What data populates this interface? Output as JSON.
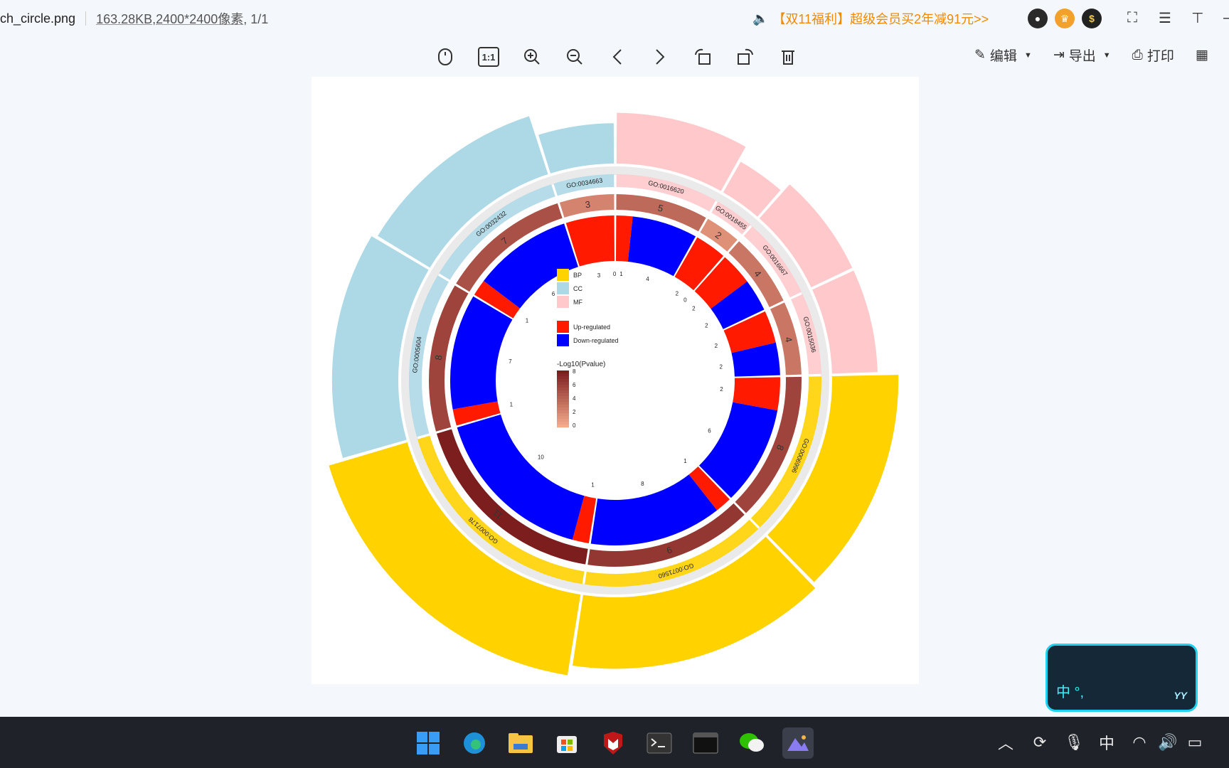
{
  "titlebar": {
    "filename": "ch_circle.png",
    "filesize": "163.28KB",
    "dimensions": ",2400*2400像素",
    "page": ", 1/1",
    "promo": "【双11福利】超级会员买2年减91元>>"
  },
  "toolbar": {
    "actual_size": "1:1",
    "edit": "编辑",
    "export": "导出",
    "print": "打印"
  },
  "chart_data": {
    "type": "circular-go-plot",
    "legend": {
      "categories": [
        {
          "name": "BP",
          "color": "#FFD200"
        },
        {
          "name": "CC",
          "color": "#ADD8E6"
        },
        {
          "name": "MF",
          "color": "#FFC9CC"
        }
      ],
      "regulation": [
        {
          "name": "Up-regulated",
          "color": "#FF1A00"
        },
        {
          "name": "Down-regulated",
          "color": "#0000FF"
        }
      ],
      "gradient_title": "-Log10(Pvalue)",
      "gradient_ticks": [
        "8",
        "6",
        "4",
        "2",
        "0"
      ]
    },
    "terms": [
      {
        "id": "GO:0016620",
        "category": "MF",
        "count": 5,
        "up": 1,
        "down": 4
      },
      {
        "id": "GO:0018455",
        "category": "MF",
        "count": 2,
        "up": 2,
        "down": 0
      },
      {
        "id": "GO:0016667",
        "category": "MF",
        "count": 4,
        "up": 2,
        "down": 2
      },
      {
        "id": "GO:0015036",
        "category": "MF",
        "count": 4,
        "up": 2,
        "down": 2
      },
      {
        "id": "GO:0006996",
        "category": "BP",
        "count": 8,
        "up": 2,
        "down": 6
      },
      {
        "id": "GO:0071560",
        "category": "BP",
        "count": 9,
        "up": 1,
        "down": 8
      },
      {
        "id": "GO:0007178",
        "category": "BP",
        "count": 11,
        "up": 1,
        "down": 10
      },
      {
        "id": "GO:0005604",
        "category": "CC",
        "count": 8,
        "up": 1,
        "down": 7
      },
      {
        "id": "GO:0032432",
        "category": "CC",
        "count": 7,
        "up": 1,
        "down": 6
      },
      {
        "id": "GO:0034663",
        "category": "CC",
        "count": 3,
        "up": 3,
        "down": 0
      }
    ]
  }
}
